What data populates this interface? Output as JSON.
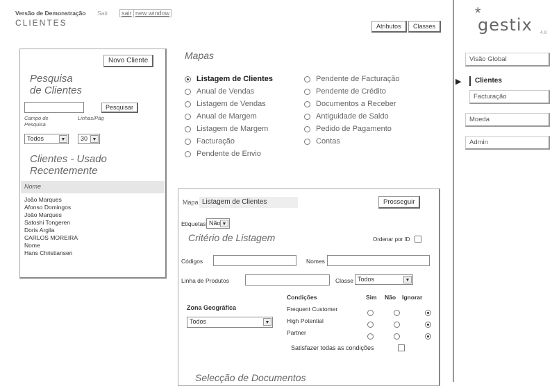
{
  "header": {
    "demo_label": "Versão de Demonstração",
    "user_label": "Sair",
    "logout_link": "sair",
    "new_window_link": "new window",
    "page_title": "CLIENTES",
    "attributes_button": "Atributos",
    "classes_button": "Classes"
  },
  "search_panel": {
    "new_client_button": "Novo Cliente",
    "title_line1": "Pesquisa",
    "title_line2": "de Clientes",
    "search_button": "Pesquisar",
    "field_label": "Campo de Pesquisa",
    "rows_label": "Linhas/Pág",
    "field_value": "Todos",
    "rows_value": "30",
    "recent_title_line1": "Clientes - Usado",
    "recent_title_line2": "Recentemente",
    "recent_header": "Nome",
    "recent_clients": [
      "João Marques",
      "Afonso Domingos",
      "João Marques",
      "Satoshi Tongeren",
      "Doris Argila",
      "CARLOS MOREIRA",
      "Nome",
      "Hans Christiansen"
    ]
  },
  "maps": {
    "title": "Mapas",
    "left_items": [
      {
        "label": "Listagem de Clientes",
        "selected": true
      },
      {
        "label": "Anual de Vendas",
        "selected": false
      },
      {
        "label": "Listagem de Vendas",
        "selected": false
      },
      {
        "label": "Anual de Margem",
        "selected": false
      },
      {
        "label": "Listagem de Margem",
        "selected": false
      },
      {
        "label": "Facturação",
        "selected": false
      },
      {
        "label": "Pendente de Envio",
        "selected": false
      }
    ],
    "right_items": [
      {
        "label": "Pendente de Facturação",
        "selected": false
      },
      {
        "label": "Pendente de Crédito",
        "selected": false
      },
      {
        "label": "Documentos a Receber",
        "selected": false
      },
      {
        "label": "Antiguidade de Saldo",
        "selected": false
      },
      {
        "label": "Pedido de Pagamento",
        "selected": false
      },
      {
        "label": "Contas",
        "selected": false
      }
    ]
  },
  "listing": {
    "map_label": "Mapa",
    "map_value": "Listagem de Clientes",
    "proceed_button": "Prosseguir",
    "labels_label": "Etiquetas",
    "labels_value": "Não",
    "criteria_title": "Critério de Listagem",
    "order_by_id_label": "Ordenar por ID",
    "codes_label": "Códigos",
    "names_label": "Nomes",
    "product_line_label": "Linha de Produtos",
    "class_label": "Classe",
    "class_value": "Todos",
    "conditions_title": "Condições",
    "col_yes": "Sim",
    "col_no": "Não",
    "col_ignore": "Ignorar",
    "geo_zone_label": "Zona Geográfica",
    "geo_zone_value": "Todos",
    "conditions": [
      {
        "label": "Frequent Customer",
        "value": "ignore"
      },
      {
        "label": "High Potential",
        "value": "ignore"
      },
      {
        "label": "Partner",
        "value": "ignore"
      }
    ],
    "satisfy_all_label": "Satisfazer todas as condições",
    "doc_selection_title": "Selecção de Documentos"
  },
  "sidebar": {
    "logo_text": "gestix",
    "logo_version": "4.0",
    "items": [
      {
        "label": "Visão Global",
        "active": false
      },
      {
        "label": "Clientes",
        "active": true
      },
      {
        "label": "Facturação",
        "active": false
      },
      {
        "label": "Moeda",
        "active": false
      },
      {
        "label": "Admin",
        "active": false
      }
    ]
  }
}
